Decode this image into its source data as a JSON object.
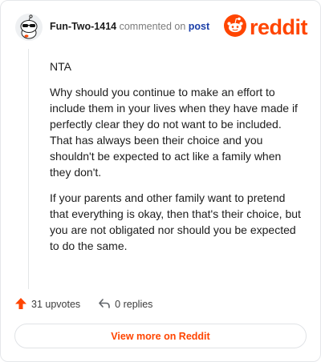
{
  "comment": {
    "author": "Fun-Two-1414",
    "commented_text": "commented on",
    "post_link": "post",
    "paragraphs": [
      "NTA",
      "Why should you continue to make an effort to include them in your lives when they have made if perfectly clear they do not want to be included. That has always been their choice and you shouldn't be expected to act like a family when they don't.",
      "If your parents and other family want to pretend that everything is okay, then that's their choice, but you are not obligated nor should you be expected to do the same."
    ],
    "upvotes": "31 upvotes",
    "replies": "0 replies"
  },
  "brand": {
    "wordmark": "reddit",
    "color": "#ff4500"
  },
  "footer": {
    "view_more": "View more on Reddit"
  },
  "icons": {
    "upvote": "upvote-arrow-icon",
    "reply": "reply-arrow-icon",
    "logo": "reddit-snoo-icon",
    "avatar": "snoo-avatar-icon"
  }
}
